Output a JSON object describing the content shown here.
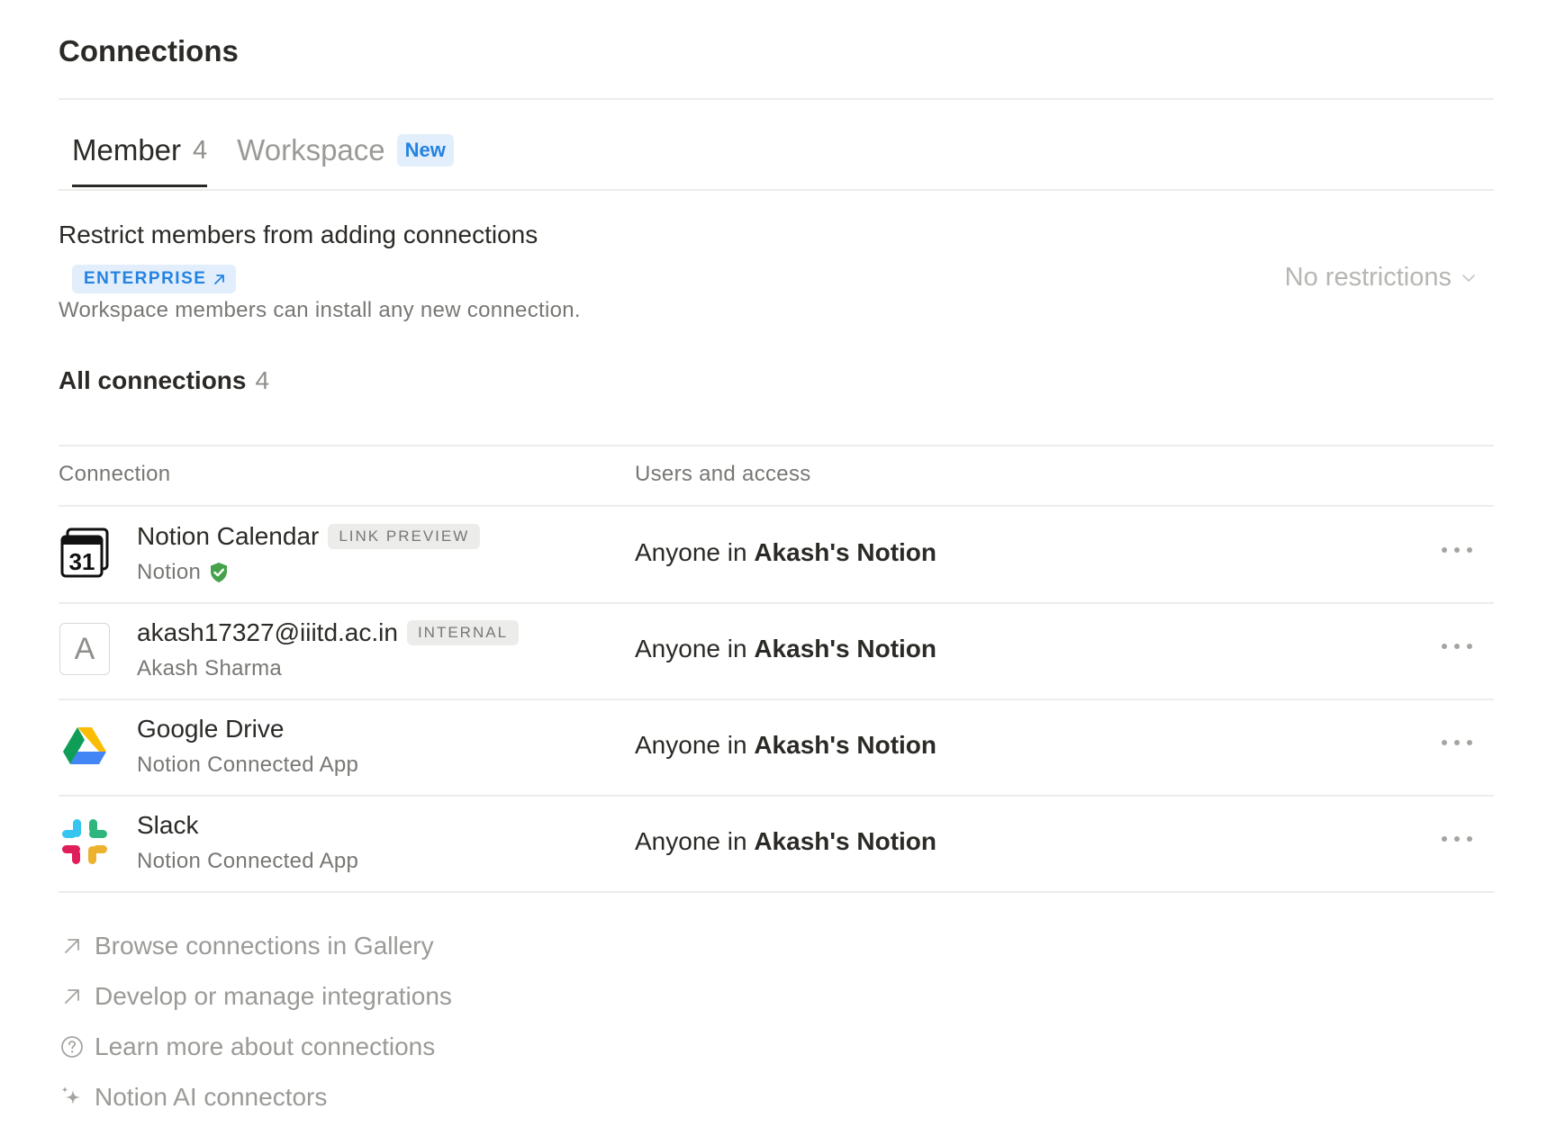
{
  "title": "Connections",
  "tabs": {
    "member": {
      "label": "Member",
      "count": "4"
    },
    "workspace": {
      "label": "Workspace",
      "badge": "New"
    }
  },
  "restrict": {
    "title": "Restrict members from adding connections",
    "enterprise_badge": "ENTERPRISE",
    "description": "Workspace members can install any new connection.",
    "dropdown_value": "No restrictions"
  },
  "all_connections": {
    "label": "All connections",
    "count": "4"
  },
  "table": {
    "headers": {
      "connection": "Connection",
      "access": "Users and access"
    },
    "rows": [
      {
        "name": "Notion Calendar",
        "tag": "LINK PREVIEW",
        "sub": "Notion",
        "verified": true,
        "icon": "notion-calendar-icon",
        "calendar_day": "31",
        "access_prefix": "Anyone in ",
        "access_bold": "Akash's Notion"
      },
      {
        "name": "akash17327@iiitd.ac.in",
        "tag": "INTERNAL",
        "sub": "Akash Sharma",
        "icon": "letter-avatar",
        "avatar_letter": "A",
        "access_prefix": "Anyone in ",
        "access_bold": "Akash's Notion"
      },
      {
        "name": "Google Drive",
        "sub": "Notion Connected App",
        "icon": "google-drive-icon",
        "access_prefix": "Anyone in ",
        "access_bold": "Akash's Notion"
      },
      {
        "name": "Slack",
        "sub": "Notion Connected App",
        "icon": "slack-icon",
        "access_prefix": "Anyone in ",
        "access_bold": "Akash's Notion"
      }
    ]
  },
  "links": [
    {
      "label": "Browse connections in Gallery",
      "icon": "arrow-up-right-icon"
    },
    {
      "label": "Develop or manage integrations",
      "icon": "arrow-up-right-icon"
    },
    {
      "label": "Learn more about connections",
      "icon": "question-circle-icon"
    },
    {
      "label": "Notion AI connectors",
      "icon": "sparkle-icon"
    }
  ],
  "colors": {
    "accent": "#2383e2",
    "accent_bg": "#e3eefc",
    "verified": "#45a24a",
    "text": "#2b2a26",
    "muted": "#787774"
  }
}
